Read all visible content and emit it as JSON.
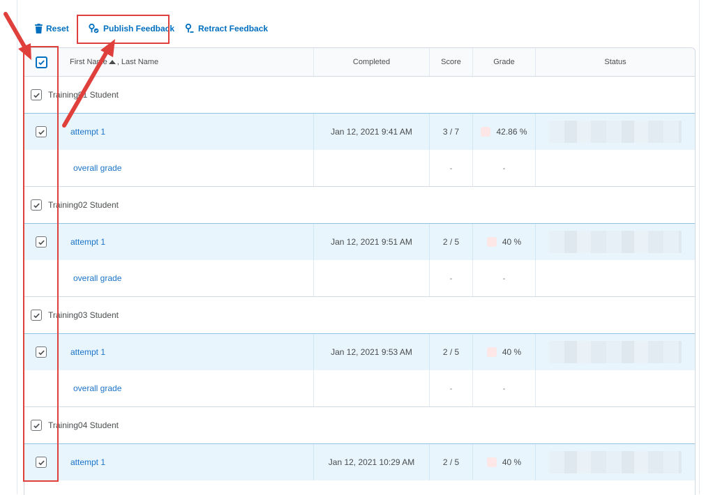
{
  "toolbar": {
    "reset_label": "Reset",
    "publish_label": "Publish Feedback",
    "retract_label": "Retract Feedback"
  },
  "table": {
    "headers": {
      "name_first": "First Name",
      "name_last": ", Last Name",
      "completed": "Completed",
      "score": "Score",
      "grade": "Grade",
      "status": "Status"
    },
    "students": [
      {
        "name": "Training01 Student",
        "attempt_label": "attempt 1",
        "completed": "Jan 12, 2021 9:41 AM",
        "score": "3 / 7",
        "grade": "42.86 %",
        "overall_label": "overall grade",
        "overall_score": "-",
        "overall_grade": "-"
      },
      {
        "name": "Training02 Student",
        "attempt_label": "attempt 1",
        "completed": "Jan 12, 2021 9:51 AM",
        "score": "2 / 5",
        "grade": "40 %",
        "overall_label": "overall grade",
        "overall_score": "-",
        "overall_grade": "-"
      },
      {
        "name": "Training03 Student",
        "attempt_label": "attempt 1",
        "completed": "Jan 12, 2021 9:53 AM",
        "score": "2 / 5",
        "grade": "40 %",
        "overall_label": "overall grade",
        "overall_score": "-",
        "overall_grade": "-"
      },
      {
        "name": "Training04 Student",
        "attempt_label": "attempt 1",
        "completed": "Jan 12, 2021 10:29 AM",
        "score": "2 / 5",
        "grade": "40 %"
      }
    ]
  },
  "colors": {
    "link": "#006fbf",
    "annotation": "#e0403c",
    "selected_row": "#e8f5fc"
  },
  "icons": {
    "reset": "trash-icon",
    "publish": "publish-feedback-icon",
    "retract": "retract-feedback-icon",
    "sort": "sort-ascending-icon",
    "checkbox": "checkmark-icon"
  }
}
